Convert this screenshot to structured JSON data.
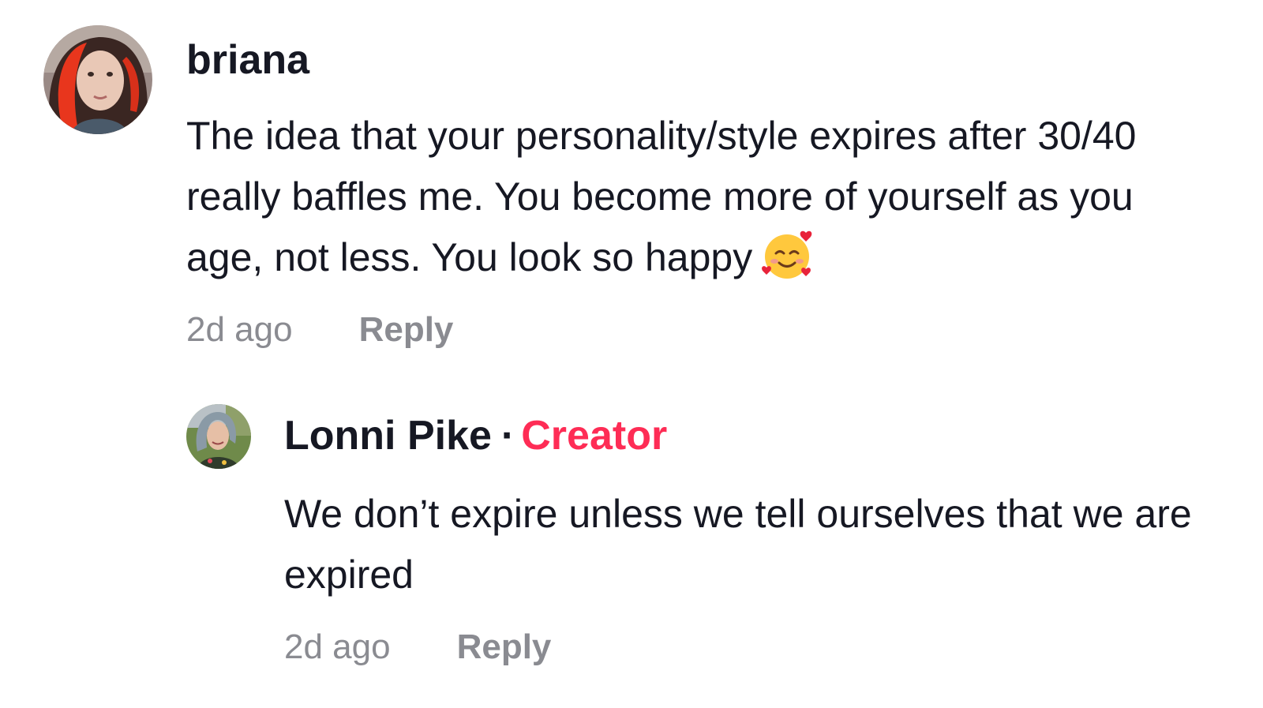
{
  "comments": [
    {
      "username": "briana",
      "text": "The idea that your personality/style expires after 30/40 really baffles me. You become more of yourself as you age, not less. You look so happy",
      "emoji": "smiling-face-with-hearts-icon",
      "time": "2d ago",
      "reply_label": "Reply"
    }
  ],
  "reply": {
    "username": "Lonni Pike",
    "separator": "·",
    "badge": "Creator",
    "text": "We don’t expire unless we tell ourselves that we are expired",
    "time": "2d ago",
    "reply_label": "Reply"
  },
  "colors": {
    "text": "#161823",
    "muted": "#8a8b91",
    "creator": "#fe2c55"
  }
}
